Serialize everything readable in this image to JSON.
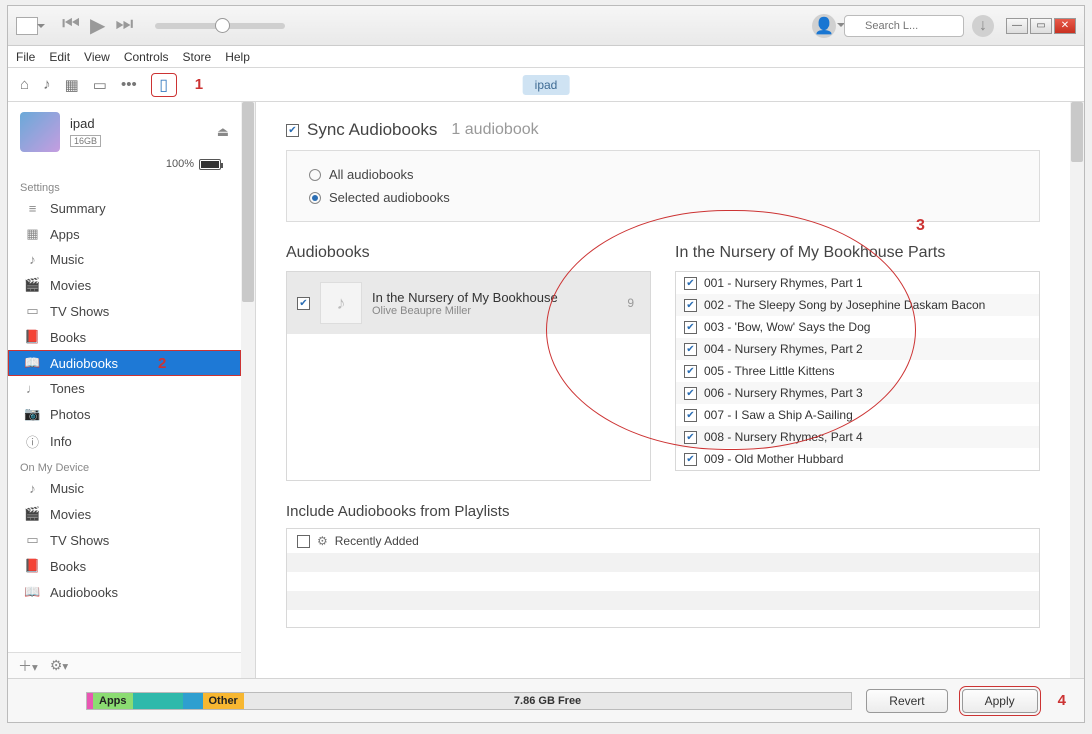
{
  "menubar": [
    "File",
    "Edit",
    "View",
    "Controls",
    "Store",
    "Help"
  ],
  "search_placeholder": "Search L...",
  "device_pill": "ipad",
  "callouts": {
    "one": "1",
    "two": "2",
    "three": "3",
    "four": "4"
  },
  "device": {
    "name": "ipad",
    "capacity": "16GB",
    "battery": "100%"
  },
  "sidebar": {
    "settings_label": "Settings",
    "settings": [
      {
        "label": "Summary",
        "icon": "≡"
      },
      {
        "label": "Apps",
        "icon": "▦"
      },
      {
        "label": "Music",
        "icon": "♪"
      },
      {
        "label": "Movies",
        "icon": "🎬"
      },
      {
        "label": "TV Shows",
        "icon": "▭"
      },
      {
        "label": "Books",
        "icon": "📕"
      },
      {
        "label": "Audiobooks",
        "icon": "📖",
        "selected": true
      },
      {
        "label": "Tones",
        "icon": "♩"
      },
      {
        "label": "Photos",
        "icon": "📷"
      },
      {
        "label": "Info",
        "icon": "ⓘ"
      }
    ],
    "ondevice_label": "On My Device",
    "ondevice": [
      {
        "label": "Music",
        "icon": "♪"
      },
      {
        "label": "Movies",
        "icon": "🎬"
      },
      {
        "label": "TV Shows",
        "icon": "▭"
      },
      {
        "label": "Books",
        "icon": "📕"
      },
      {
        "label": "Audiobooks",
        "icon": "📖"
      }
    ]
  },
  "sync": {
    "title": "Sync Audiobooks",
    "count": "1 audiobook",
    "opt_all": "All audiobooks",
    "opt_selected": "Selected audiobooks"
  },
  "audiobooks": {
    "heading": "Audiobooks",
    "items": [
      {
        "title": "In the Nursery of My Bookhouse",
        "author": "Olive Beaupre Miller",
        "count": "9"
      }
    ]
  },
  "parts": {
    "heading": "In the Nursery of My Bookhouse Parts",
    "list": [
      "001 - Nursery Rhymes, Part 1",
      "002 - The Sleepy Song by Josephine Daskam Bacon",
      "003 - 'Bow, Wow' Says the Dog",
      "004 - Nursery Rhymes, Part 2",
      "005 - Three Little Kittens",
      "006 - Nursery Rhymes, Part 3",
      "007 - I Saw a Ship A-Sailing",
      "008 - Nursery Rhymes, Part 4",
      "009 - Old Mother Hubbard"
    ]
  },
  "playlists": {
    "heading": "Include Audiobooks from Playlists",
    "item": "Recently Added"
  },
  "footer": {
    "apps": "Apps",
    "other": "Other",
    "free": "7.86 GB Free",
    "revert": "Revert",
    "apply": "Apply"
  }
}
